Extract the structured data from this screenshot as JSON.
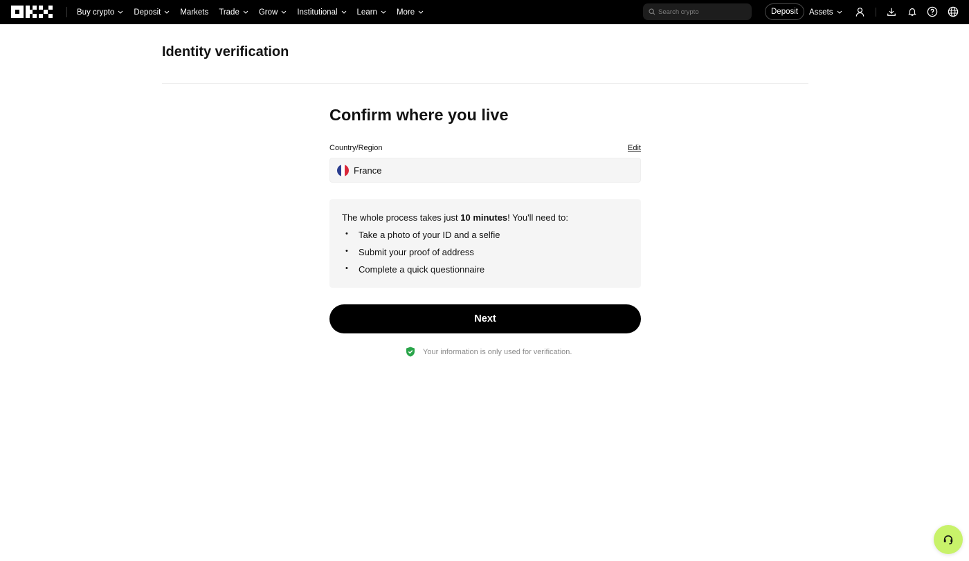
{
  "header": {
    "logo_alt": "OKX",
    "nav": [
      {
        "label": "Buy crypto",
        "has_dropdown": true
      },
      {
        "label": "Deposit",
        "has_dropdown": true
      },
      {
        "label": "Markets",
        "has_dropdown": false
      },
      {
        "label": "Trade",
        "has_dropdown": true
      },
      {
        "label": "Grow",
        "has_dropdown": true
      },
      {
        "label": "Institutional",
        "has_dropdown": true
      },
      {
        "label": "Learn",
        "has_dropdown": true
      },
      {
        "label": "More",
        "has_dropdown": true
      }
    ],
    "search_placeholder": "Search crypto",
    "deposit_button": "Deposit",
    "assets_label": "Assets",
    "icons": [
      "user-icon",
      "download-icon",
      "bell-icon",
      "help-icon",
      "globe-icon"
    ]
  },
  "page": {
    "title": "Identity verification"
  },
  "form": {
    "heading": "Confirm where you live",
    "country_label": "Country/Region",
    "edit_label": "Edit",
    "country_value": "France",
    "flag_icon": "france-flag-icon",
    "info": {
      "intro_before": "The whole process takes just ",
      "intro_bold": "10 minutes",
      "intro_after": "! You'll need to:",
      "steps": [
        "Take a photo of your ID and a selfie",
        "Submit your proof of address",
        "Complete a quick questionnaire"
      ]
    },
    "next_button": "Next",
    "privacy_note": "Your information is only used for verification."
  },
  "colors": {
    "topbar": "#000000",
    "primary_button": "#000000",
    "panel": "#f5f5f5",
    "shield": "#2aa54a",
    "chat_fab": "#c8f26a"
  }
}
